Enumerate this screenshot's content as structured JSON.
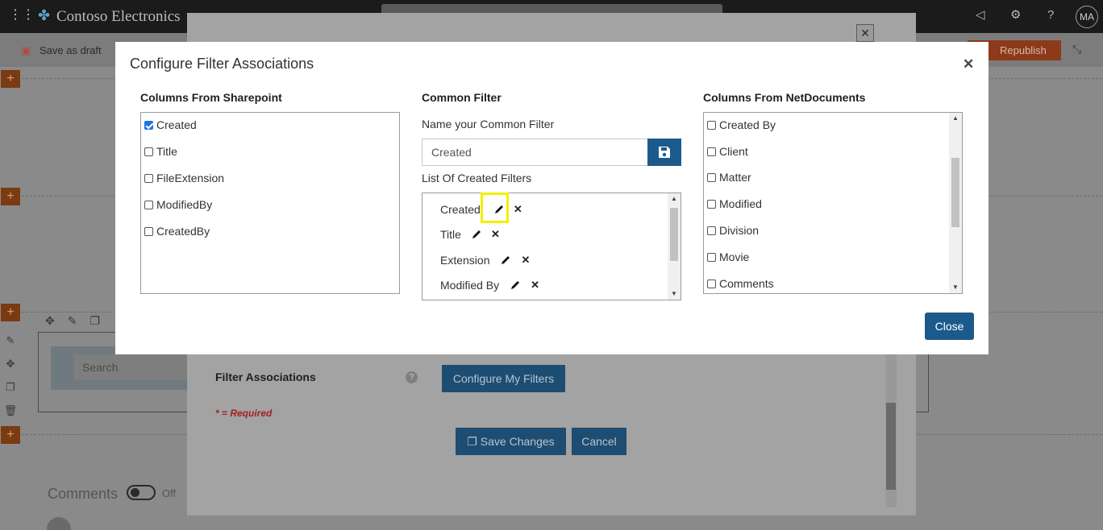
{
  "suite": {
    "brand": "Contoso Electronics",
    "avatar": "MA"
  },
  "command_bar": {
    "save_draft": "Save as draft",
    "republish": "Republish"
  },
  "background_page": {
    "search_placeholder": "Search",
    "comments_label": "Comments",
    "comments_toggle": "Off"
  },
  "edit_panel": {
    "close_symbol": "✕",
    "filter_associations_label": "Filter Associations",
    "help_symbol": "?",
    "configure_button": "Configure My Filters",
    "required_note": "* = Required",
    "save_button": "Save Changes",
    "cancel_button": "Cancel"
  },
  "modal": {
    "title": "Configure Filter Associations",
    "close_symbol": "✕",
    "sharepoint": {
      "title": "Columns From Sharepoint",
      "items": [
        {
          "label": "Created",
          "checked": true
        },
        {
          "label": "Title",
          "checked": false
        },
        {
          "label": "FileExtension",
          "checked": false
        },
        {
          "label": "ModifiedBy",
          "checked": false
        },
        {
          "label": "CreatedBy",
          "checked": false
        }
      ]
    },
    "common_filter": {
      "title": "Common Filter",
      "name_label": "Name your Common Filter",
      "name_value": "Created",
      "list_label": "List Of Created Filters",
      "filters": [
        "Created",
        "Title",
        "Extension",
        "Modified By"
      ],
      "delete_symbol": "✕"
    },
    "netdocuments": {
      "title": "Columns From NetDocuments",
      "items": [
        {
          "label": "Created By",
          "checked": false
        },
        {
          "label": "Client",
          "checked": false
        },
        {
          "label": "Matter",
          "checked": false
        },
        {
          "label": "Modified",
          "checked": false
        },
        {
          "label": "Division",
          "checked": false
        },
        {
          "label": "Movie",
          "checked": false
        },
        {
          "label": "Comments",
          "checked": false
        }
      ]
    },
    "close_button": "Close"
  },
  "colors": {
    "primary_button": "#1d5a8c",
    "highlight": "#f0f000",
    "checkbox_checked": "#1a73e8"
  }
}
